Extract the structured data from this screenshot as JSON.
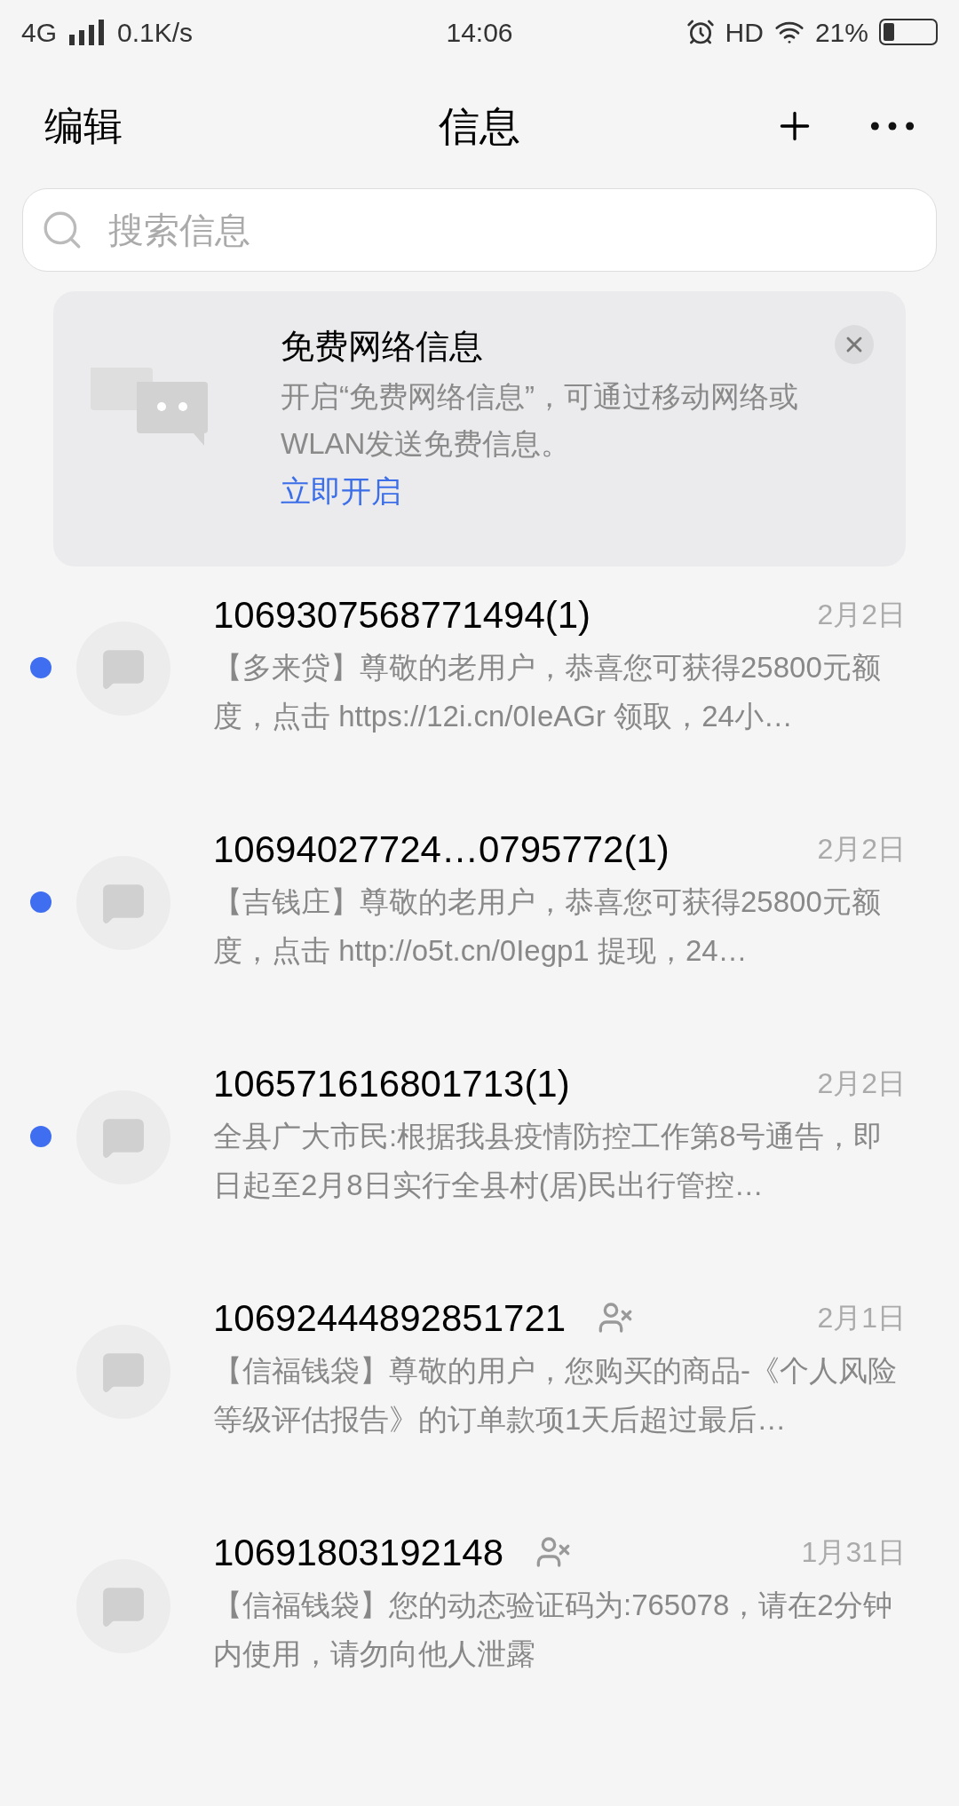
{
  "status_bar": {
    "network": "4G",
    "speed": "0.1K/s",
    "time": "14:06",
    "hd": "HD",
    "battery": "21%"
  },
  "header": {
    "edit": "编辑",
    "title": "信息"
  },
  "search": {
    "placeholder": "搜索信息"
  },
  "banner": {
    "title": "免费网络信息",
    "body": "开启“免费网络信息”，可通过移动网络或WLAN发送免费信息。",
    "action": "立即开启"
  },
  "messages": [
    {
      "sender": "1069307568771494(1)",
      "date": "2月2日",
      "unread": true,
      "blocked": false,
      "preview": "【多来贷】尊敬的老用户，恭喜您可获得25800元额度，点击 https://12i.cn/0IeAGr 领取，24小…"
    },
    {
      "sender": "10694027724…0795772(1)",
      "date": "2月2日",
      "unread": true,
      "blocked": false,
      "preview": "【吉钱庄】尊敬的老用户，恭喜您可获得25800元额度，点击 http://o5t.cn/0Iegp1 提现，24…"
    },
    {
      "sender": "106571616801713(1)",
      "date": "2月2日",
      "unread": true,
      "blocked": false,
      "preview": "全县广大市民:根据我县疫情防控工作第8号通告，即日起至2月8日实行全县村(居)民出行管控…"
    },
    {
      "sender": "10692444892851721",
      "date": "2月1日",
      "unread": false,
      "blocked": true,
      "preview": "【信福钱袋】尊敬的用户，您购买的商品-《个人风险等级评估报告》的订单款项1天后超过最后…"
    },
    {
      "sender": "10691803192148",
      "date": "1月31日",
      "unread": false,
      "blocked": true,
      "preview": "【信福钱袋】您的动态验证码为:765078，请在2分钟内使用，请勿向他人泄露"
    }
  ]
}
